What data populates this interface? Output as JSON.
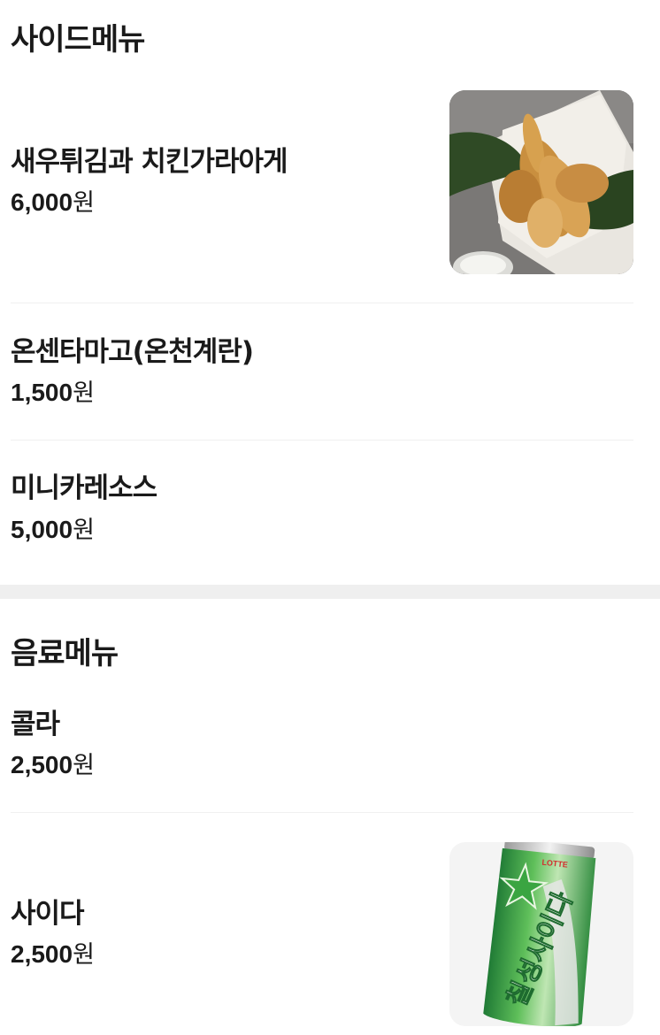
{
  "side_menu": {
    "title": "사이드메뉴",
    "items": [
      {
        "name": "새우튀김과 치킨가라아게",
        "price": "6,000",
        "unit": "원"
      },
      {
        "name": "온센타마고(온천계란)",
        "price": "1,500",
        "unit": "원"
      },
      {
        "name": "미니카레소스",
        "price": "5,000",
        "unit": "원"
      }
    ]
  },
  "drink_menu": {
    "title": "음료메뉴",
    "items": [
      {
        "name": "콜라",
        "price": "2,500",
        "unit": "원"
      },
      {
        "name": "사이다",
        "price": "2,500",
        "unit": "원"
      }
    ]
  },
  "cider_can": {
    "brand": "LOTTE",
    "label": "칠성사이다"
  }
}
